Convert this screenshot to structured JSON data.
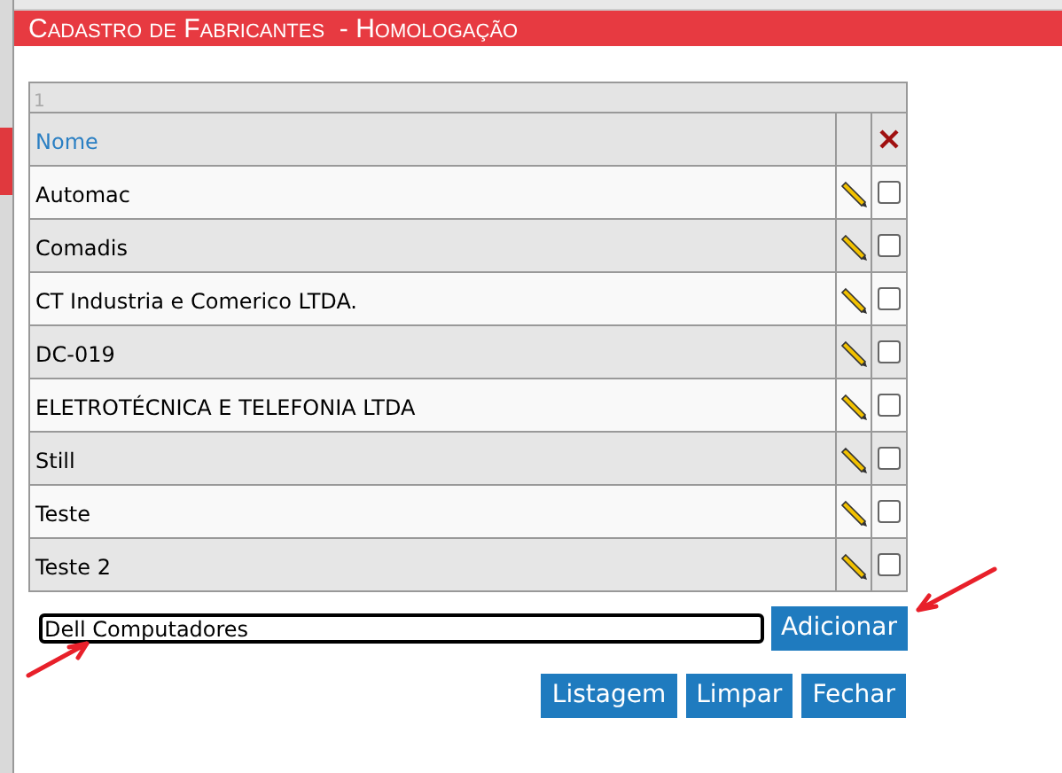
{
  "header": {
    "title": "Cadastro de Fabricantes  - Homologação"
  },
  "table": {
    "page": "1",
    "columns": [
      {
        "label": "Nome",
        "kind": "text"
      },
      {
        "kind": "edit"
      },
      {
        "kind": "delete"
      }
    ],
    "rows": [
      {
        "name": "Automac",
        "checked": false
      },
      {
        "name": "Comadis",
        "checked": false
      },
      {
        "name": "CT Industria e Comerico LTDA.",
        "checked": false
      },
      {
        "name": "DC-019",
        "checked": false
      },
      {
        "name": "ELETROTÉCNICA E TELEFONIA LTDA",
        "checked": false
      },
      {
        "name": "Still",
        "checked": false
      },
      {
        "name": "Teste",
        "checked": false
      },
      {
        "name": "Teste 2",
        "checked": false
      }
    ]
  },
  "new_item": {
    "value": "Dell Computadores",
    "button": "Adicionar"
  },
  "buttons": [
    "Listagem",
    "Limpar",
    "Fechar"
  ]
}
